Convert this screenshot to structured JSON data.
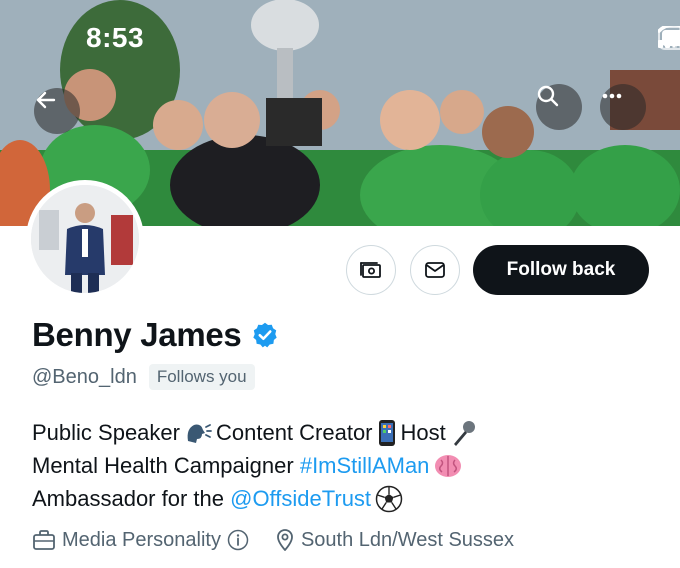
{
  "status_bar": {
    "time": "8:53",
    "icons": [
      "cellular-signal-icon",
      "wifi-icon",
      "battery-icon"
    ]
  },
  "header": {
    "back_icon": "arrow-left-icon",
    "search_icon": "search-icon",
    "more_icon": "more-horizontal-icon"
  },
  "profile": {
    "name": "Benny James",
    "verified": true,
    "handle": "@Beno_ldn",
    "follows_you": "Follows you",
    "bio": {
      "line1": {
        "t1": "Public Speaker",
        "t2": "Content Creator",
        "t3": "Host"
      },
      "line2": {
        "t1": "Mental Health Campaigner",
        "hashtag": "#ImStillAMan"
      },
      "line3": {
        "t1": "Ambassador for the",
        "mention": "@OffsideTrust"
      }
    },
    "category": "Media Personality",
    "location": "South Ldn/West Sussex"
  },
  "actions": {
    "tip_icon": "money-icon",
    "message_icon": "envelope-icon",
    "follow_label": "Follow back"
  },
  "colors": {
    "accent": "#1d9bf0",
    "text": "#0f1419",
    "secondary": "#536471",
    "button_dark": "#0f1419",
    "verified": "#1d9bf0"
  }
}
